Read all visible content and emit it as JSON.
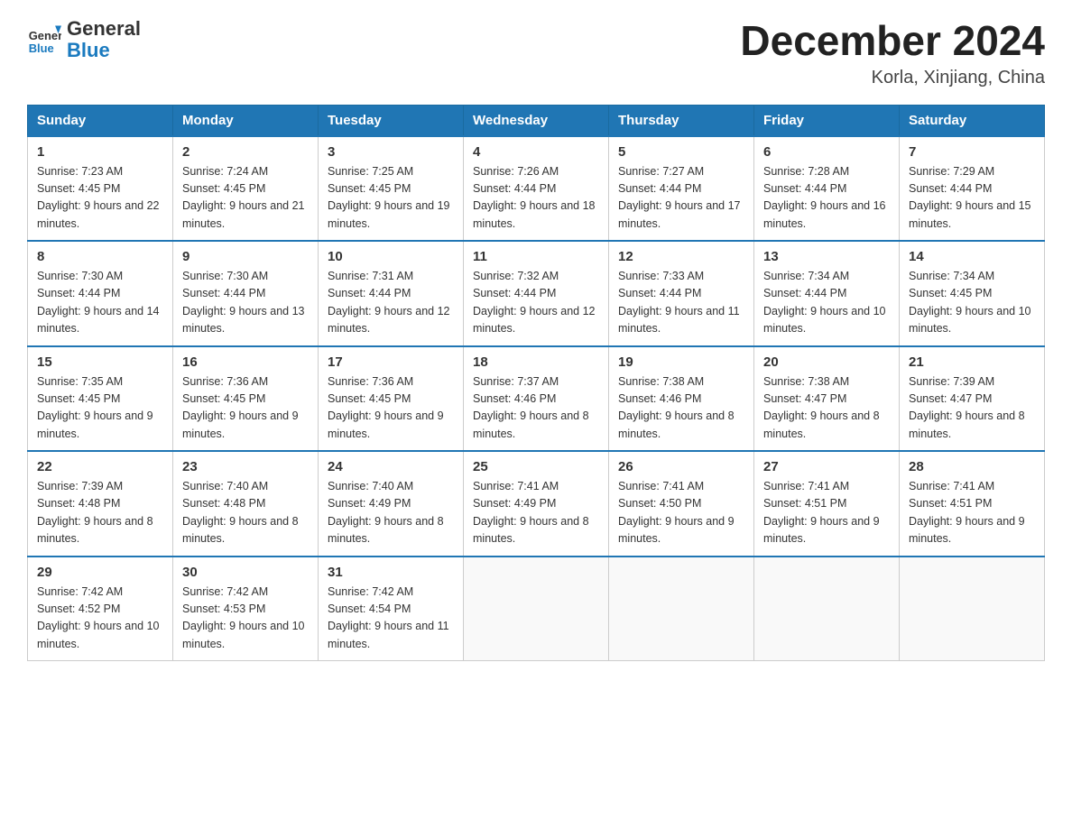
{
  "header": {
    "logo_general": "General",
    "logo_blue": "Blue",
    "month_title": "December 2024",
    "location": "Korla, Xinjiang, China"
  },
  "weekdays": [
    "Sunday",
    "Monday",
    "Tuesday",
    "Wednesday",
    "Thursday",
    "Friday",
    "Saturday"
  ],
  "weeks": [
    [
      {
        "day": "1",
        "sunrise": "7:23 AM",
        "sunset": "4:45 PM",
        "daylight": "9 hours and 22 minutes."
      },
      {
        "day": "2",
        "sunrise": "7:24 AM",
        "sunset": "4:45 PM",
        "daylight": "9 hours and 21 minutes."
      },
      {
        "day": "3",
        "sunrise": "7:25 AM",
        "sunset": "4:45 PM",
        "daylight": "9 hours and 19 minutes."
      },
      {
        "day": "4",
        "sunrise": "7:26 AM",
        "sunset": "4:44 PM",
        "daylight": "9 hours and 18 minutes."
      },
      {
        "day": "5",
        "sunrise": "7:27 AM",
        "sunset": "4:44 PM",
        "daylight": "9 hours and 17 minutes."
      },
      {
        "day": "6",
        "sunrise": "7:28 AM",
        "sunset": "4:44 PM",
        "daylight": "9 hours and 16 minutes."
      },
      {
        "day": "7",
        "sunrise": "7:29 AM",
        "sunset": "4:44 PM",
        "daylight": "9 hours and 15 minutes."
      }
    ],
    [
      {
        "day": "8",
        "sunrise": "7:30 AM",
        "sunset": "4:44 PM",
        "daylight": "9 hours and 14 minutes."
      },
      {
        "day": "9",
        "sunrise": "7:30 AM",
        "sunset": "4:44 PM",
        "daylight": "9 hours and 13 minutes."
      },
      {
        "day": "10",
        "sunrise": "7:31 AM",
        "sunset": "4:44 PM",
        "daylight": "9 hours and 12 minutes."
      },
      {
        "day": "11",
        "sunrise": "7:32 AM",
        "sunset": "4:44 PM",
        "daylight": "9 hours and 12 minutes."
      },
      {
        "day": "12",
        "sunrise": "7:33 AM",
        "sunset": "4:44 PM",
        "daylight": "9 hours and 11 minutes."
      },
      {
        "day": "13",
        "sunrise": "7:34 AM",
        "sunset": "4:44 PM",
        "daylight": "9 hours and 10 minutes."
      },
      {
        "day": "14",
        "sunrise": "7:34 AM",
        "sunset": "4:45 PM",
        "daylight": "9 hours and 10 minutes."
      }
    ],
    [
      {
        "day": "15",
        "sunrise": "7:35 AM",
        "sunset": "4:45 PM",
        "daylight": "9 hours and 9 minutes."
      },
      {
        "day": "16",
        "sunrise": "7:36 AM",
        "sunset": "4:45 PM",
        "daylight": "9 hours and 9 minutes."
      },
      {
        "day": "17",
        "sunrise": "7:36 AM",
        "sunset": "4:45 PM",
        "daylight": "9 hours and 9 minutes."
      },
      {
        "day": "18",
        "sunrise": "7:37 AM",
        "sunset": "4:46 PM",
        "daylight": "9 hours and 8 minutes."
      },
      {
        "day": "19",
        "sunrise": "7:38 AM",
        "sunset": "4:46 PM",
        "daylight": "9 hours and 8 minutes."
      },
      {
        "day": "20",
        "sunrise": "7:38 AM",
        "sunset": "4:47 PM",
        "daylight": "9 hours and 8 minutes."
      },
      {
        "day": "21",
        "sunrise": "7:39 AM",
        "sunset": "4:47 PM",
        "daylight": "9 hours and 8 minutes."
      }
    ],
    [
      {
        "day": "22",
        "sunrise": "7:39 AM",
        "sunset": "4:48 PM",
        "daylight": "9 hours and 8 minutes."
      },
      {
        "day": "23",
        "sunrise": "7:40 AM",
        "sunset": "4:48 PM",
        "daylight": "9 hours and 8 minutes."
      },
      {
        "day": "24",
        "sunrise": "7:40 AM",
        "sunset": "4:49 PM",
        "daylight": "9 hours and 8 minutes."
      },
      {
        "day": "25",
        "sunrise": "7:41 AM",
        "sunset": "4:49 PM",
        "daylight": "9 hours and 8 minutes."
      },
      {
        "day": "26",
        "sunrise": "7:41 AM",
        "sunset": "4:50 PM",
        "daylight": "9 hours and 9 minutes."
      },
      {
        "day": "27",
        "sunrise": "7:41 AM",
        "sunset": "4:51 PM",
        "daylight": "9 hours and 9 minutes."
      },
      {
        "day": "28",
        "sunrise": "7:41 AM",
        "sunset": "4:51 PM",
        "daylight": "9 hours and 9 minutes."
      }
    ],
    [
      {
        "day": "29",
        "sunrise": "7:42 AM",
        "sunset": "4:52 PM",
        "daylight": "9 hours and 10 minutes."
      },
      {
        "day": "30",
        "sunrise": "7:42 AM",
        "sunset": "4:53 PM",
        "daylight": "9 hours and 10 minutes."
      },
      {
        "day": "31",
        "sunrise": "7:42 AM",
        "sunset": "4:54 PM",
        "daylight": "9 hours and 11 minutes."
      },
      null,
      null,
      null,
      null
    ]
  ]
}
